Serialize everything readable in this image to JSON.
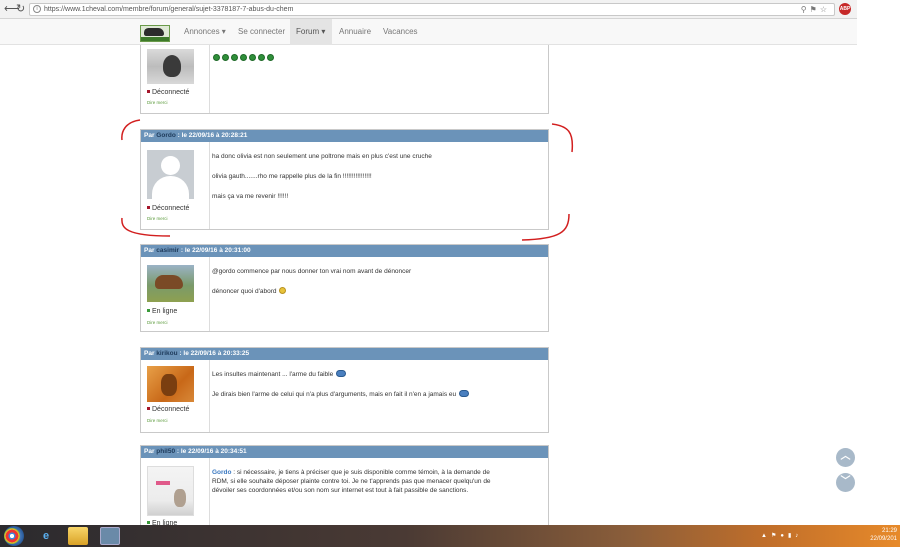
{
  "browser": {
    "url": "https://www.1cheval.com/membre/forum/general/sujet-3378187-7-abus-du-chem",
    "back_glyph": "⟵",
    "reload_glyph": "↻",
    "extension_label": "ABP"
  },
  "site_nav": {
    "items": [
      {
        "label": "Annonces ▾"
      },
      {
        "label": "Se connecter"
      },
      {
        "label": "Forum ▾"
      },
      {
        "label": "Annuaire"
      },
      {
        "label": "Vacances"
      }
    ]
  },
  "posts": [
    {
      "status": "Déconnecté",
      "thanks_label": "Dire merci"
    },
    {
      "header_prefix": "Par ",
      "author": "Gordo",
      "header_suffix": " : le 22/09/16 à 20:28:21",
      "status": "Déconnecté",
      "thanks_label": "Dire merci",
      "lines": [
        "ha donc olivia est non seulement une poltrone mais en plus c'est une cruche",
        "olivia gauth.......rho me rappelle plus de la fin !!!!!!!!!!!!!!!!",
        "mais ça va me revenir !!!!!!"
      ]
    },
    {
      "header_prefix": "Par ",
      "author": "casimir",
      "header_suffix": " : le 22/09/16 à 20:31:00",
      "status": "En ligne",
      "thanks_label": "Dire merci",
      "lines": [
        "@gordo commence par nous donner ton vrai nom avant de dénoncer",
        "dénoncer quoi d'abord"
      ]
    },
    {
      "header_prefix": "Par ",
      "author": "kirikou",
      "header_suffix": " : le 22/09/16 à 20:33:25",
      "status": "Déconnecté",
      "thanks_label": "Dire merci",
      "lines": [
        "Les insultes maintenant ... l'arme du faible",
        "Je dirais bien l'arme de celui qui n'a plus d'arguments, mais en fait il n'en a jamais eu"
      ]
    },
    {
      "header_prefix": "Par ",
      "author": "phil50",
      "header_suffix": " : le 22/09/16 à 20:34:51",
      "status": "En ligne",
      "quote_name": "Gordo",
      "lines": [
        " : si nécessaire, je tiens à préciser que je suis disponible comme témoin, à la demande de",
        "RDM, si elle souhaite déposer plainte contre toi. Je ne t'apprends pas que menacer quelqu'un de",
        "dévoiler ses coordonnées et/ou son nom sur internet est tout à fait passible de sanctions."
      ]
    }
  ],
  "scroll": {
    "up": "︿",
    "down": "﹀"
  },
  "taskbar": {
    "time": "21:29",
    "date": "22/09/201"
  }
}
